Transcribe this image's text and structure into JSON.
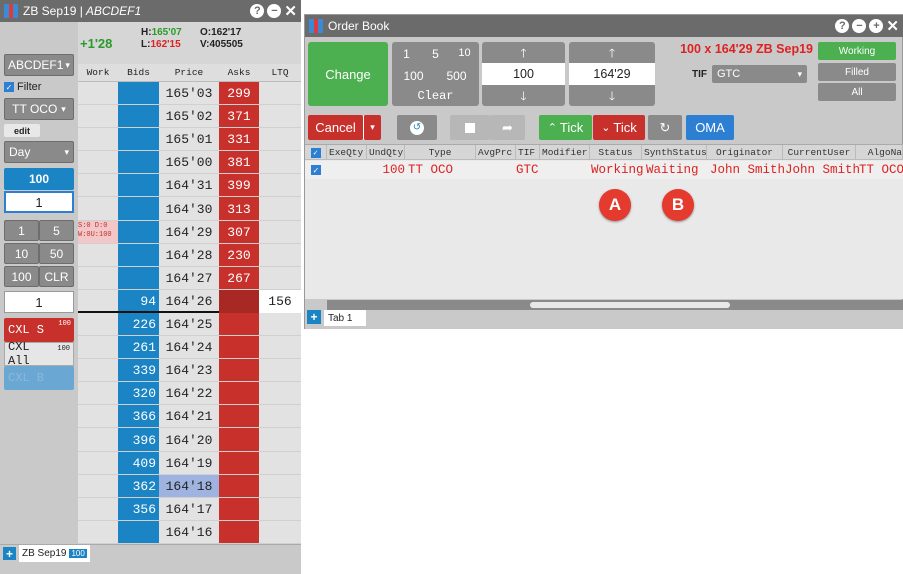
{
  "left_window": {
    "title_symbol": "ZB Sep19 |",
    "title_account": "ABCDEF1",
    "net_change": "+1'28",
    "high_label": "H:",
    "high": "165'07",
    "open_label": "O:",
    "open": "162'17",
    "low_label": "L:",
    "low": "162'15",
    "volume_label": "V:",
    "volume": "405505",
    "account_select": "ABCDEF1",
    "filter_label": "Filter",
    "order_type": "TT OCO",
    "edit_label": "edit",
    "tif": "Day",
    "qty_display": "100",
    "qty_input": "1",
    "qty_buttons": [
      "1",
      "5",
      "10",
      "50",
      "100",
      "CLR"
    ],
    "qty_field": "1",
    "cxl_s": "CXL S",
    "cxl_s_count": "100",
    "cxl_all": "CXL All",
    "cxl_all_count": "100",
    "cxl_b": "CXL B",
    "col_headers": [
      "Work",
      "Bids",
      "Price",
      "Asks",
      "LTQ"
    ],
    "work_annotation_1": "S:0  D:0",
    "work_annotation_2": "W:0U:100",
    "ladder": [
      {
        "price": "165'03",
        "bid": "",
        "ask": "299",
        "ltq": ""
      },
      {
        "price": "165'02",
        "bid": "",
        "ask": "371",
        "ltq": ""
      },
      {
        "price": "165'01",
        "bid": "",
        "ask": "331",
        "ltq": ""
      },
      {
        "price": "165'00",
        "bid": "",
        "ask": "381",
        "ltq": ""
      },
      {
        "price": "164'31",
        "bid": "",
        "ask": "399",
        "ltq": ""
      },
      {
        "price": "164'30",
        "bid": "",
        "ask": "313",
        "ltq": ""
      },
      {
        "price": "164'29",
        "bid": "",
        "ask": "307",
        "ltq": ""
      },
      {
        "price": "164'28",
        "bid": "",
        "ask": "230",
        "ltq": ""
      },
      {
        "price": "164'27",
        "bid": "",
        "ask": "267",
        "ltq": ""
      },
      {
        "price": "164'26",
        "bid": "94",
        "ask": "",
        "ltq": "156"
      },
      {
        "price": "164'25",
        "bid": "226",
        "ask": "",
        "ltq": ""
      },
      {
        "price": "164'24",
        "bid": "261",
        "ask": "",
        "ltq": ""
      },
      {
        "price": "164'23",
        "bid": "339",
        "ask": "",
        "ltq": ""
      },
      {
        "price": "164'22",
        "bid": "320",
        "ask": "",
        "ltq": ""
      },
      {
        "price": "164'21",
        "bid": "366",
        "ask": "",
        "ltq": ""
      },
      {
        "price": "164'20",
        "bid": "396",
        "ask": "",
        "ltq": ""
      },
      {
        "price": "164'19",
        "bid": "409",
        "ask": "",
        "ltq": ""
      },
      {
        "price": "164'18",
        "bid": "362",
        "ask": "",
        "ltq": ""
      },
      {
        "price": "164'17",
        "bid": "356",
        "ask": "",
        "ltq": ""
      },
      {
        "price": "164'16",
        "bid": "",
        "ask": "",
        "ltq": ""
      }
    ],
    "tab_label": "ZB Sep19",
    "tab_badge": "100"
  },
  "order_book": {
    "title": "Order Book",
    "change_label": "Change",
    "qty_buttons": [
      "1",
      "5",
      "10",
      "100",
      "500"
    ],
    "clear_label": "Clear",
    "qty_value": "100",
    "price_value": "164'29",
    "order_summary": "100 x 164'29 ZB Sep19",
    "tif_label": "TIF",
    "tif_value": "GTC",
    "working_label": "Working",
    "filled_label": "Filled",
    "all_label": "All",
    "cancel_label": "Cancel",
    "up_tick_label": "Tick",
    "down_tick_label": "Tick",
    "oma_label": "OMA",
    "columns": [
      "ExeQty",
      "UndQty",
      "Type",
      "AvgPrc",
      "TIF",
      "Modifier",
      "Status",
      "SynthStatus",
      "Originator",
      "CurrentUser",
      "AlgoNa"
    ],
    "row": {
      "exeqty": "",
      "undqty": "100",
      "type": "TT OCO",
      "avgprc": "",
      "tif": "GTC",
      "modifier": "",
      "status": "Working",
      "synthstatus": "Waiting",
      "originator": "John Smith",
      "currentuser": "John Smith",
      "algoname": "TT OCO"
    },
    "tab_label": "Tab 1"
  },
  "callouts": {
    "a": "A",
    "b": "B"
  },
  "colors": {
    "ask_red": "#c8302c",
    "bid_blue": "#1a84c4",
    "title_gray": "#6b6b6b",
    "green": "#4caf50"
  }
}
